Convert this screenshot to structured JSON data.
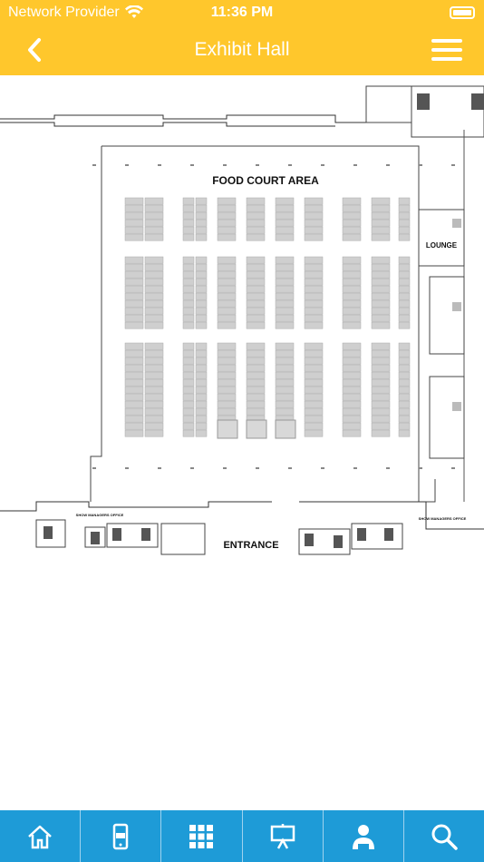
{
  "status": {
    "carrier": "Network Provider",
    "time": "11:36 PM"
  },
  "nav": {
    "title": "Exhibit Hall"
  },
  "map": {
    "food_court": "FOOD COURT AREA",
    "lounge": "LOUNGE",
    "entrance": "ENTRANCE",
    "show_office": "SHOW MANAGERS OFFICE"
  },
  "tabs": [
    {
      "icon": "home-icon"
    },
    {
      "icon": "mobile-icon"
    },
    {
      "icon": "grid-icon"
    },
    {
      "icon": "presentation-icon"
    },
    {
      "icon": "speaker-icon"
    },
    {
      "icon": "search-icon"
    }
  ],
  "colors": {
    "header": "#FFC72C",
    "tabbar": "#1E9BD7",
    "booth": "#cfcfcf"
  }
}
